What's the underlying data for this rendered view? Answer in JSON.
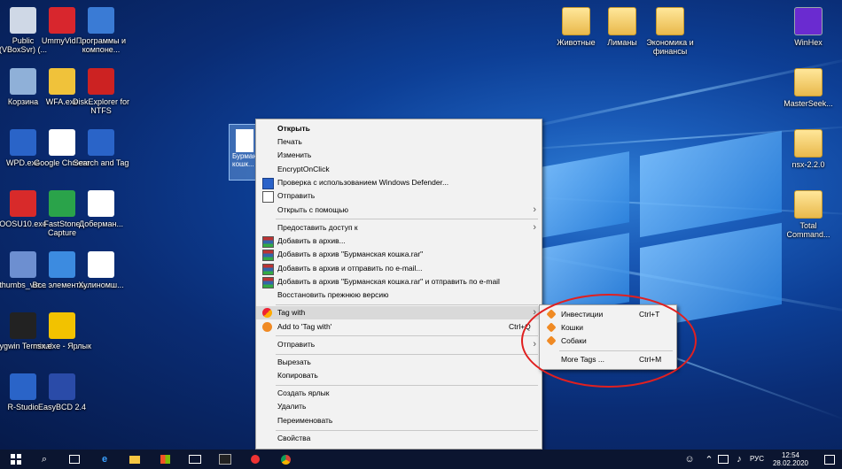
{
  "desktop_icons_left": [
    {
      "name": "public-vboxsvr",
      "label": "Public (VBoxSvr) (...",
      "icon": "network-drive-icon"
    },
    {
      "name": "ummyvideo",
      "label": "UmmyVid...",
      "icon": "download-app-icon"
    },
    {
      "name": "programs",
      "label": "Программы и компоне...",
      "icon": "programs-icon"
    },
    {
      "name": "recycle-bin",
      "label": "Корзина",
      "icon": "recycle-bin-icon"
    },
    {
      "name": "wfa",
      "label": "WFA.exe",
      "icon": "wfa-icon"
    },
    {
      "name": "diskexplorer",
      "label": "DiskExplorer for NTFS",
      "icon": "disk-explorer-icon"
    },
    {
      "name": "wpd",
      "label": "WPD.exe",
      "icon": "wpd-icon"
    },
    {
      "name": "chrome",
      "label": "Google Chrome",
      "icon": "chrome-icon"
    },
    {
      "name": "searchtag",
      "label": "Search and Tag",
      "icon": "search-tag-icon"
    },
    {
      "name": "oosu10",
      "label": "OOSU10.exe",
      "icon": "oosu-icon"
    },
    {
      "name": "faststone",
      "label": "FastStone Capture",
      "icon": "faststone-icon"
    },
    {
      "name": "doberman",
      "label": "Доберман...",
      "icon": "document-icon"
    },
    {
      "name": "thumbs",
      "label": "thumbs_vie...",
      "icon": "thumbs-icon"
    },
    {
      "name": "all-elements",
      "label": "Все элементы...",
      "icon": "control-panel-icon"
    },
    {
      "name": "huliganom",
      "label": "Хулиномш...",
      "icon": "text-file-icon"
    },
    {
      "name": "cygwin",
      "label": "Cygwin Terminal",
      "icon": "terminal-icon"
    },
    {
      "name": "nsx-shortcut",
      "label": "nsx.exe - Ярлык",
      "icon": "nsx-icon"
    },
    {
      "name": "rstudio",
      "label": "R-Studio",
      "icon": "rstudio-icon"
    },
    {
      "name": "easybcd",
      "label": "EasyBCD 2.4",
      "icon": "easybcd-icon"
    }
  ],
  "desktop_icons_right": [
    {
      "name": "animals",
      "label": "Животные",
      "icon": "folder-icon"
    },
    {
      "name": "limany",
      "label": "Лиманы",
      "icon": "folder-icon"
    },
    {
      "name": "economics",
      "label": "Экономика и финансы",
      "icon": "folder-icon"
    },
    {
      "name": "winhex",
      "label": "WinHex",
      "icon": "winhex-icon"
    },
    {
      "name": "masterseeker",
      "label": "MasterSeek...",
      "icon": "folder-icon"
    },
    {
      "name": "nsx220",
      "label": "nsx-2.2.0",
      "icon": "folder-icon"
    },
    {
      "name": "totalcommander",
      "label": "Total Command...",
      "icon": "folder-icon"
    }
  ],
  "selected_file_label": "Бурман кошк...",
  "context_menu": {
    "open": "Открыть",
    "print": "Печать",
    "edit": "Изменить",
    "encrypt": "EncryptOnClick",
    "defender": "Проверка с использованием Windows Defender...",
    "share": "Отправить",
    "open_with": "Открыть с помощью",
    "grant_access": "Предоставить доступ к",
    "add_archive": "Добавить в архив...",
    "add_rar": "Добавить в архив \"Бурманская кошка.rar\"",
    "add_email": "Добавить в архив и отправить по e-mail...",
    "add_rar_email": "Добавить в архив \"Бурманская кошка.rar\" и отправить по e-mail",
    "restore": "Восстановить прежнюю версию",
    "tag_with": "Tag with",
    "add_to_tag": "Add to 'Tag with'",
    "add_to_tag_shortcut": "Ctrl+Q",
    "send_to": "Отправить",
    "cut": "Вырезать",
    "copy": "Копировать",
    "create_shortcut": "Создать ярлык",
    "delete": "Удалить",
    "rename": "Переименовать",
    "properties": "Свойства"
  },
  "submenu": {
    "items": [
      {
        "label": "Инвестиции",
        "shortcut": "Ctrl+T"
      },
      {
        "label": "Кошки",
        "shortcut": ""
      },
      {
        "label": "Собаки",
        "shortcut": ""
      }
    ],
    "more_tags": "More Tags ...",
    "more_tags_shortcut": "Ctrl+M"
  },
  "taskbar": {
    "language": "РУС",
    "time": "12:54",
    "date": "28.02.2020"
  },
  "colors": {
    "highlight_ellipse": "#e02020",
    "tag_icon": "#f08a24",
    "taskbar": "#0b1530"
  }
}
